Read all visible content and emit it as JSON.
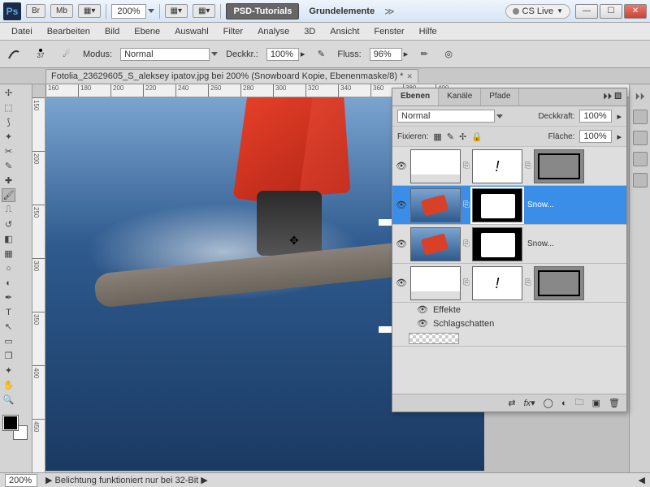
{
  "titlebar": {
    "br": "Br",
    "mb": "Mb",
    "zoom": "200%",
    "psd_tutorials": "PSD-Tutorials",
    "grundelemente": "Grundelemente",
    "cslive": "CS Live"
  },
  "menu": [
    "Datei",
    "Bearbeiten",
    "Bild",
    "Ebene",
    "Auswahl",
    "Filter",
    "Analyse",
    "3D",
    "Ansicht",
    "Fenster",
    "Hilfe"
  ],
  "optbar": {
    "brush_size": "37",
    "modus_label": "Modus:",
    "modus_value": "Normal",
    "deckkr_label": "Deckkr.:",
    "deckkr_value": "100%",
    "fluss_label": "Fluss:",
    "fluss_value": "96%"
  },
  "doc": {
    "title": "Fotolia_23629605_S_aleksey ipatov.jpg bei 200% (Snowboard Kopie, Ebenenmaske/8) *"
  },
  "ruler_h": [
    "160",
    "180",
    "200",
    "220",
    "240",
    "260",
    "280",
    "300",
    "320",
    "340",
    "360",
    "380",
    "400"
  ],
  "ruler_v": [
    "150",
    "200",
    "250",
    "300",
    "350",
    "400",
    "450"
  ],
  "layers": {
    "tabs": [
      "Ebenen",
      "Kanäle",
      "Pfade"
    ],
    "blend_mode": "Normal",
    "deckkraft_label": "Deckkraft:",
    "deckkraft_value": "100%",
    "fixieren_label": "Fixieren:",
    "flaeche_label": "Fläche:",
    "flaeche_value": "100%",
    "layer2_name": "Snow...",
    "layer3_name": "Snow...",
    "effekte": "Effekte",
    "schlagschatten": "Schlagschatten"
  },
  "status": {
    "zoom": "200%",
    "msg": "Belichtung funktioniert nur bei 32-Bit"
  }
}
